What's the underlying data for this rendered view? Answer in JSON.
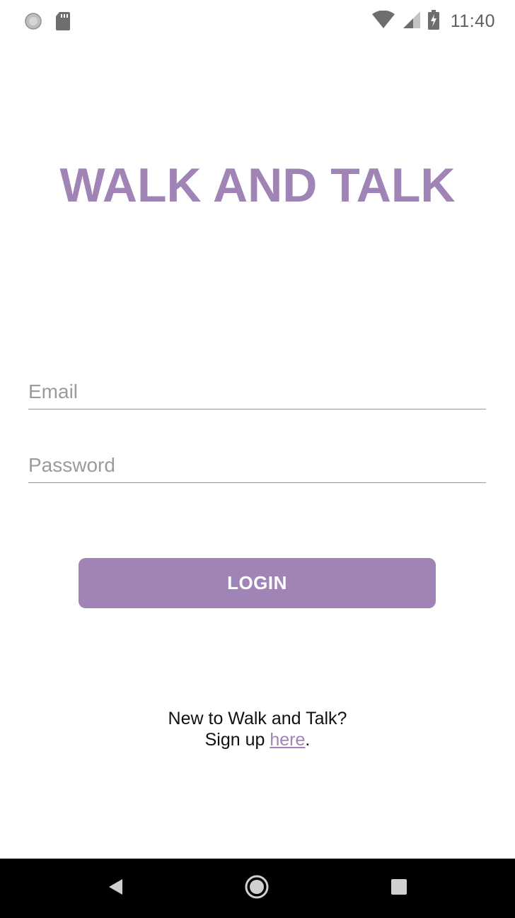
{
  "status_bar": {
    "time": "11:40",
    "left_icons": [
      "loading-spinner-icon",
      "sd-card-icon"
    ],
    "right_icons": [
      "wifi-icon",
      "cell-signal-icon",
      "battery-charging-icon"
    ]
  },
  "app": {
    "title": "WALK AND TALK",
    "accent_color": "#a184b6"
  },
  "form": {
    "email_placeholder": "Email",
    "email_value": "",
    "password_placeholder": "Password",
    "password_value": "",
    "login_label": "LOGIN"
  },
  "signup": {
    "line1": "New to Walk and Talk?",
    "prefix": "Sign up ",
    "link_label": "here",
    "suffix": "."
  },
  "nav_bar": {
    "buttons": [
      "back-icon",
      "home-icon",
      "recents-icon"
    ]
  }
}
